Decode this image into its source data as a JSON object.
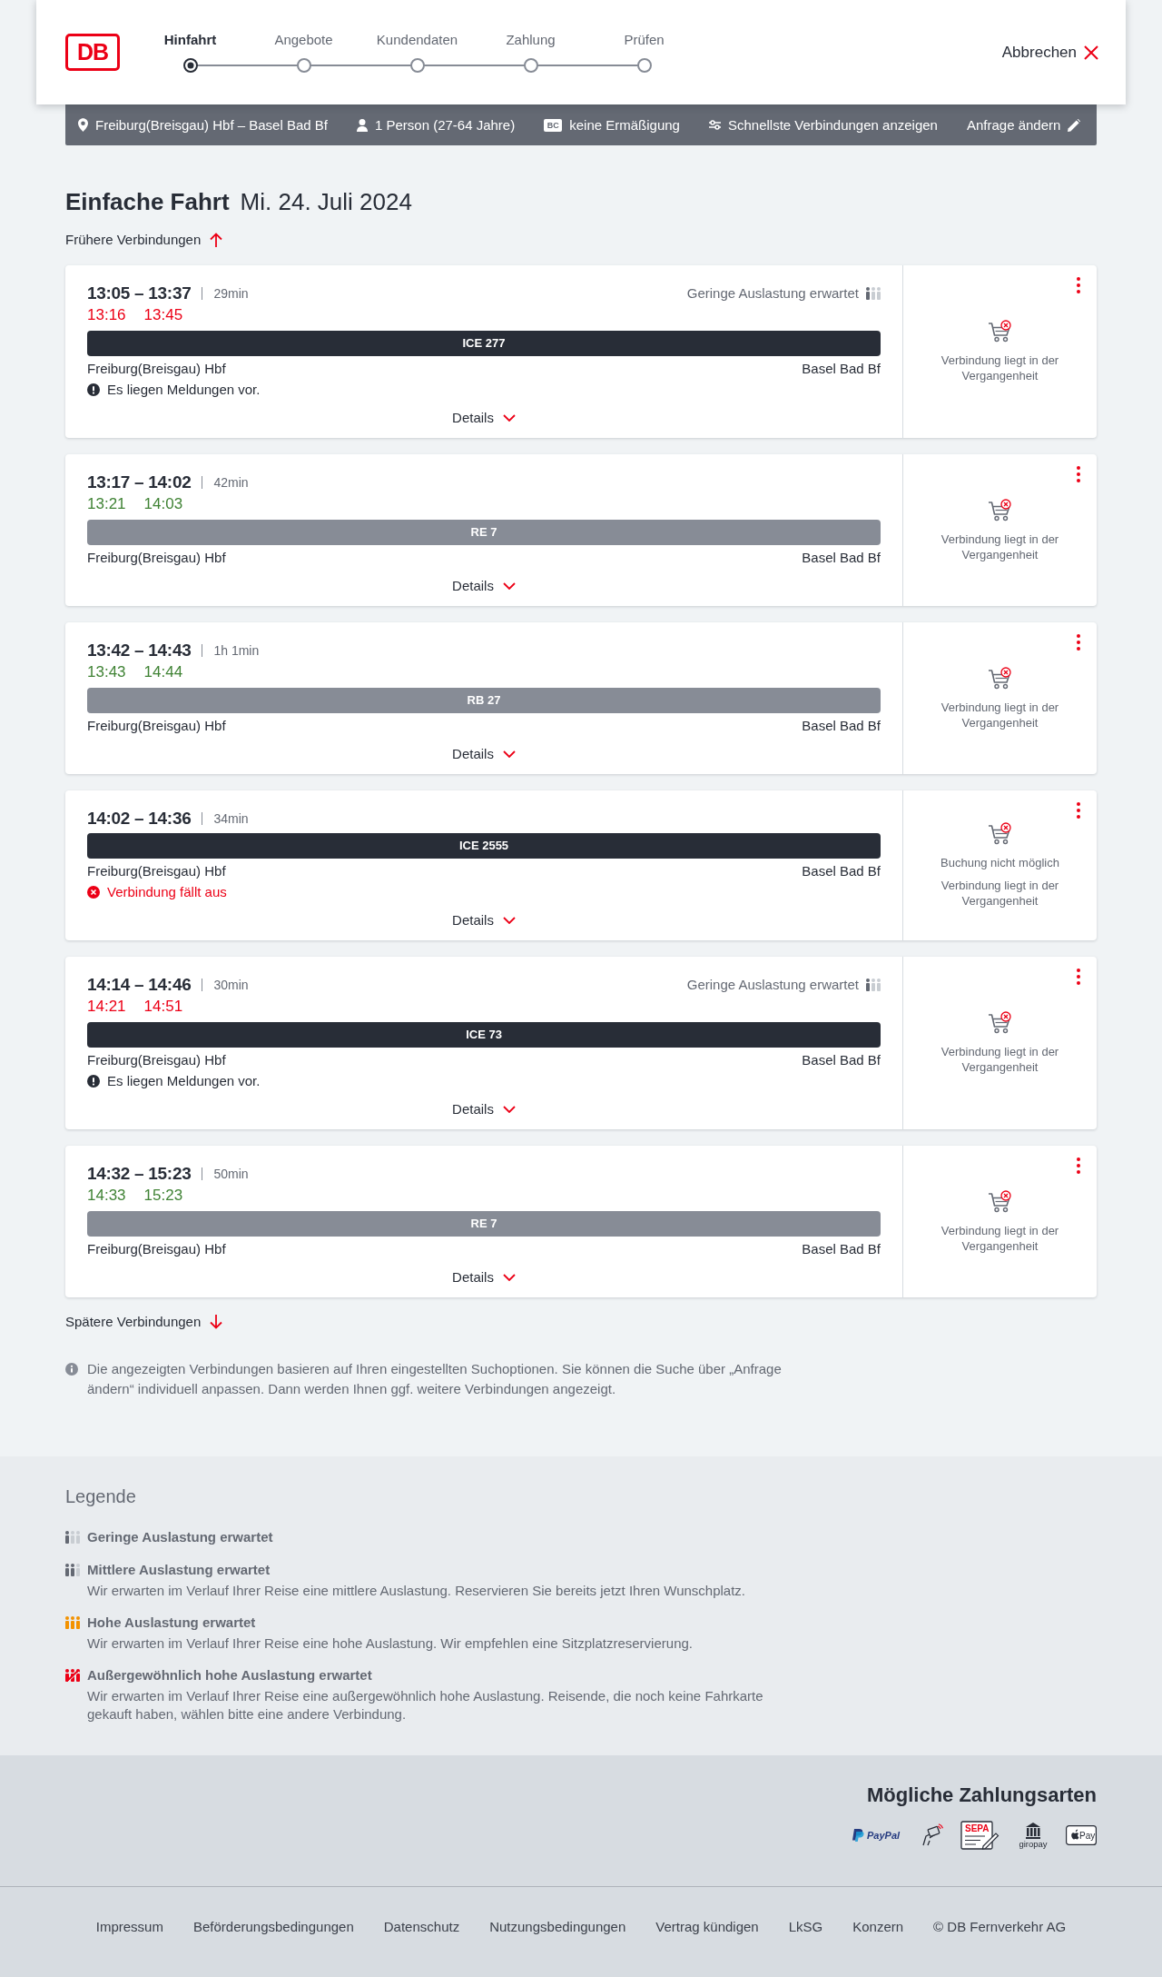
{
  "header": {
    "logo": "DB",
    "steps": [
      {
        "label": "Hinfahrt",
        "selected": true
      },
      {
        "label": "Angebote",
        "selected": false
      },
      {
        "label": "Kundendaten",
        "selected": false
      },
      {
        "label": "Zahlung",
        "selected": false
      },
      {
        "label": "Prüfen",
        "selected": false
      }
    ],
    "cancel": "Abbrechen"
  },
  "search_summary": {
    "items": [
      {
        "kind": "location",
        "text": "Freiburg(Breisgau) Hbf – Basel Bad Bf"
      },
      {
        "kind": "person",
        "text": "1 Person (27-64 Jahre)"
      },
      {
        "kind": "bahncard",
        "badge": "BC",
        "text": "keine Ermäßigung"
      },
      {
        "kind": "filter",
        "text": "Schnellste Verbindungen anzeigen"
      }
    ],
    "edit": "Anfrage ändern"
  },
  "page_title": {
    "title": "Einfache Fahrt",
    "date": "Mi. 24. Juli 2024"
  },
  "earlier_link": "Frühere Verbindungen",
  "connections": [
    {
      "times": "13:05 – 13:37",
      "duration": "29min",
      "realtime": [
        {
          "time": "13:16",
          "delayed": true
        },
        {
          "time": "13:45",
          "delayed": true
        }
      ],
      "occupancy": {
        "kind": "low",
        "text": "Geringe Auslastung erwartet"
      },
      "train": {
        "name": "ICE 277",
        "kind": "long_distance"
      },
      "from": "Freiburg(Breisgau) Hbf",
      "to": "Basel Bad Bf",
      "notice": {
        "kind": "messages",
        "text": "Es liegen Meldungen vor."
      },
      "details": "Details",
      "booking": [
        "Verbindung liegt in der Vergangenheit"
      ]
    },
    {
      "times": "13:17 – 14:02",
      "duration": "42min",
      "realtime": [
        {
          "time": "13:21",
          "delayed": false
        },
        {
          "time": "14:03",
          "delayed": false
        }
      ],
      "train": {
        "name": "RE 7",
        "kind": "regional"
      },
      "from": "Freiburg(Breisgau) Hbf",
      "to": "Basel Bad Bf",
      "details": "Details",
      "booking": [
        "Verbindung liegt in der Vergangenheit"
      ]
    },
    {
      "times": "13:42 – 14:43",
      "duration": "1h 1min",
      "realtime": [
        {
          "time": "13:43",
          "delayed": false
        },
        {
          "time": "14:44",
          "delayed": false
        }
      ],
      "train": {
        "name": "RB 27",
        "kind": "regional"
      },
      "from": "Freiburg(Breisgau) Hbf",
      "to": "Basel Bad Bf",
      "details": "Details",
      "booking": [
        "Verbindung liegt in der Vergangenheit"
      ]
    },
    {
      "times": "14:02 – 14:36",
      "duration": "34min",
      "train": {
        "name": "ICE 2555",
        "kind": "long_distance"
      },
      "from": "Freiburg(Breisgau) Hbf",
      "to": "Basel Bad Bf",
      "notice": {
        "kind": "cancelled",
        "text": "Verbindung fällt aus"
      },
      "details": "Details",
      "booking": [
        "Buchung nicht möglich",
        "Verbindung liegt in der Vergangenheit"
      ]
    },
    {
      "times": "14:14 – 14:46",
      "duration": "30min",
      "realtime": [
        {
          "time": "14:21",
          "delayed": true
        },
        {
          "time": "14:51",
          "delayed": true
        }
      ],
      "occupancy": {
        "kind": "low",
        "text": "Geringe Auslastung erwartet"
      },
      "train": {
        "name": "ICE 73",
        "kind": "long_distance"
      },
      "from": "Freiburg(Breisgau) Hbf",
      "to": "Basel Bad Bf",
      "notice": {
        "kind": "messages",
        "text": "Es liegen Meldungen vor."
      },
      "details": "Details",
      "booking": [
        "Verbindung liegt in der Vergangenheit"
      ]
    },
    {
      "times": "14:32 – 15:23",
      "duration": "50min",
      "realtime": [
        {
          "time": "14:33",
          "delayed": false
        },
        {
          "time": "15:23",
          "delayed": false
        }
      ],
      "train": {
        "name": "RE 7",
        "kind": "regional"
      },
      "from": "Freiburg(Breisgau) Hbf",
      "to": "Basel Bad Bf",
      "details": "Details",
      "booking": [
        "Verbindung liegt in der Vergangenheit"
      ]
    }
  ],
  "later_link": "Spätere Verbindungen",
  "info_note": "Die angezeigten Verbindungen basieren auf Ihren eingestellten Suchoptionen. Sie können die Suche über „Anfrage ändern“ individuell anpassen. Dann werden Ihnen ggf. weitere Verbindungen angezeigt.",
  "legend": {
    "title": "Legende",
    "items": [
      {
        "kind": "low",
        "title": "Geringe Auslastung erwartet"
      },
      {
        "kind": "medium",
        "title": "Mittlere Auslastung erwartet",
        "description": "Wir erwarten im Verlauf Ihrer Reise eine mittlere Auslastung. Reservieren Sie bereits jetzt Ihren Wunschplatz."
      },
      {
        "kind": "high",
        "title": "Hohe Auslastung erwartet",
        "description": "Wir erwarten im Verlauf Ihrer Reise eine hohe Auslastung. Wir empfehlen eine Sitzplatzreservierung."
      },
      {
        "kind": "extreme",
        "title": "Außergewöhnlich hohe Auslastung erwartet",
        "description": "Wir erwarten im Verlauf Ihrer Reise eine außergewöhnlich hohe Auslastung. Reisende, die noch keine Fahrkarte gekauft haben, wählen bitte eine andere Verbindung."
      }
    ]
  },
  "payment": {
    "title": "Mögliche Zahlungsarten",
    "methods": [
      {
        "kind": "paypal",
        "label": "PayPal"
      },
      {
        "kind": "contactless"
      },
      {
        "kind": "sepa",
        "label": "SEPA"
      },
      {
        "kind": "giropay",
        "label": "giropay"
      },
      {
        "kind": "applepay",
        "label": "Pay"
      }
    ]
  },
  "footer": {
    "links": [
      "Impressum",
      "Beförderungsbedingungen",
      "Datenschutz",
      "Nutzungsbedingungen",
      "Vertrag kündigen",
      "LkSG",
      "Konzern",
      "© DB Fernverkehr AG"
    ]
  }
}
